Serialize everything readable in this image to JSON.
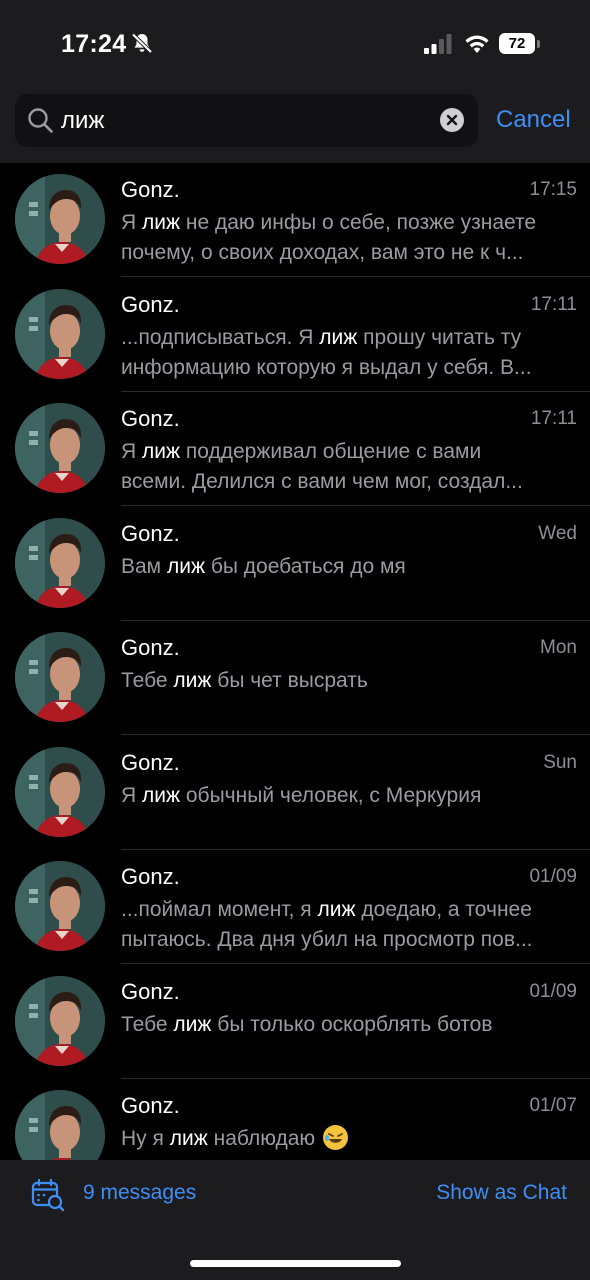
{
  "status_bar": {
    "time": "17:24",
    "battery": "72",
    "icons": [
      "bell-slash-icon",
      "signal-icon",
      "wifi-icon",
      "battery-icon"
    ]
  },
  "search": {
    "query": "лиж",
    "cancel_label": "Cancel",
    "icons": [
      "search-icon",
      "clear-icon"
    ]
  },
  "results": [
    {
      "name": "Gonz.",
      "date": "17:15",
      "lines": [
        [
          "Я ",
          "лиж",
          " не даю инфы о себе, позже узнаете"
        ],
        [
          "почему, о своих доходах, вам это не к ч..."
        ]
      ]
    },
    {
      "name": "Gonz.",
      "date": "17:11",
      "lines": [
        [
          "...подписываться. Я ",
          "лиж",
          " прошу читать ту"
        ],
        [
          "информацию которую я выдал у себя. В..."
        ]
      ]
    },
    {
      "name": "Gonz.",
      "date": "17:11",
      "lines": [
        [
          "Я ",
          "лиж",
          " поддерживал общение с вами"
        ],
        [
          "всеми. Делился с вами чем мог, создал..."
        ]
      ]
    },
    {
      "name": "Gonz.",
      "date": "Wed",
      "lines": [
        [
          "Вам ",
          "лиж",
          " бы доебаться до мя"
        ]
      ]
    },
    {
      "name": "Gonz.",
      "date": "Mon",
      "lines": [
        [
          "Тебе ",
          "лиж",
          " бы чет высрать"
        ]
      ]
    },
    {
      "name": "Gonz.",
      "date": "Sun",
      "lines": [
        [
          "Я ",
          "лиж",
          " обычный человек, с Меркурия"
        ]
      ]
    },
    {
      "name": "Gonz.",
      "date": "01/09",
      "lines": [
        [
          "...поймал момент, я ",
          "лиж",
          " доедаю, а точнее"
        ],
        [
          "пытаюсь. Два дня убил на просмотр пов..."
        ]
      ]
    },
    {
      "name": "Gonz.",
      "date": "01/09",
      "lines": [
        [
          "Тебе ",
          "лиж",
          " бы только оскорблять ботов"
        ]
      ]
    },
    {
      "name": "Gonz.",
      "date": "01/07",
      "lines": [
        [
          "Ну я ",
          "лиж",
          " наблюдаю "
        ]
      ],
      "emoji": "rolling-on-floor-laughing-emoji"
    }
  ],
  "bottom_bar": {
    "count_label": "9 messages",
    "show_as_chat_label": "Show as Chat",
    "icons": [
      "calendar-search-icon"
    ]
  },
  "colors": {
    "accent": "#3e8ef7",
    "background": "#000000",
    "header_background": "#1c1c1e",
    "secondary_text": "#9b9ba0"
  }
}
